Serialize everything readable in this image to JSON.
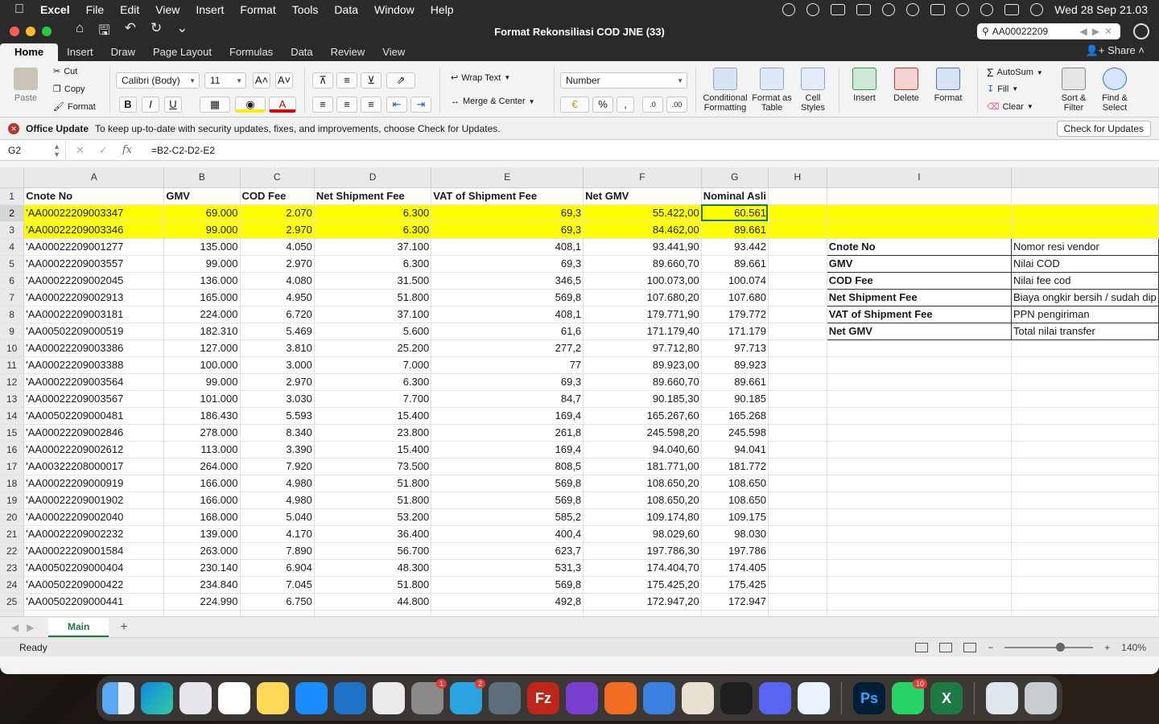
{
  "menubar": {
    "app": "Excel",
    "items": [
      "File",
      "Edit",
      "View",
      "Insert",
      "Format",
      "Tools",
      "Data",
      "Window",
      "Help"
    ],
    "clock": "Wed 28 Sep  21.03"
  },
  "window": {
    "title": "Format Rekonsiliasi COD JNE (33)",
    "search_value": "AA00022209",
    "tabs": [
      "Home",
      "Insert",
      "Draw",
      "Page Layout",
      "Formulas",
      "Data",
      "Review",
      "View"
    ],
    "share_label": "Share"
  },
  "ribbon": {
    "paste": "Paste",
    "cut": "Cut",
    "copy": "Copy",
    "format_painter": "Format",
    "font_name": "Calibri (Body)",
    "font_size": "11",
    "wrap_text": "Wrap Text",
    "merge_center": "Merge & Center",
    "number_format": "Number",
    "conditional_formatting": "Conditional Formatting",
    "format_as_table": "Format as Table",
    "cell_styles": "Cell Styles",
    "insert": "Insert",
    "delete": "Delete",
    "format": "Format",
    "autosum": "AutoSum",
    "fill": "Fill",
    "clear": "Clear",
    "sort_filter": "Sort & Filter",
    "find_select": "Find & Select"
  },
  "notice": {
    "title": "Office Update",
    "message": "To keep up-to-date with security updates, fixes, and improvements, choose Check for Updates.",
    "button": "Check for Updates"
  },
  "formula_bar": {
    "name_box": "G2",
    "formula": "=B2-C2-D2-E2"
  },
  "columns": [
    "A",
    "B",
    "C",
    "D",
    "E",
    "F",
    "G",
    "H",
    "I",
    ""
  ],
  "headers": [
    "Cnote No",
    "GMV",
    "COD Fee",
    "Net Shipment Fee",
    "VAT of Shipment Fee",
    "Net GMV",
    "Nominal Asli"
  ],
  "rows": [
    [
      "'AA00022209003347",
      "69.000",
      "2.070",
      "6.300",
      "69,3",
      "55.422,00",
      "60.561"
    ],
    [
      "'AA00022209003346",
      "99.000",
      "2.970",
      "6.300",
      "69,3",
      "84.462,00",
      "89.661"
    ],
    [
      "'AA00022209001277",
      "135.000",
      "4.050",
      "37.100",
      "408,1",
      "93.441,90",
      "93.442"
    ],
    [
      "'AA00022209003557",
      "99.000",
      "2.970",
      "6.300",
      "69,3",
      "89.660,70",
      "89.661"
    ],
    [
      "'AA00022209002045",
      "136.000",
      "4.080",
      "31.500",
      "346,5",
      "100.073,00",
      "100.074"
    ],
    [
      "'AA00022209002913",
      "165.000",
      "4.950",
      "51.800",
      "569,8",
      "107.680,20",
      "107.680"
    ],
    [
      "'AA00022209003181",
      "224.000",
      "6.720",
      "37.100",
      "408,1",
      "179.771,90",
      "179.772"
    ],
    [
      "'AA00502209000519",
      "182.310",
      "5.469",
      "5.600",
      "61,6",
      "171.179,40",
      "171.179"
    ],
    [
      "'AA00022209003386",
      "127.000",
      "3.810",
      "25.200",
      "277,2",
      "97.712,80",
      "97.713"
    ],
    [
      "'AA00022209003388",
      "100.000",
      "3.000",
      "7.000",
      "77",
      "89.923,00",
      "89.923"
    ],
    [
      "'AA00022209003564",
      "99.000",
      "2.970",
      "6.300",
      "69,3",
      "89.660,70",
      "89.661"
    ],
    [
      "'AA00022209003567",
      "101.000",
      "3.030",
      "7.700",
      "84,7",
      "90.185,30",
      "90.185"
    ],
    [
      "'AA00502209000481",
      "186.430",
      "5.593",
      "15.400",
      "169,4",
      "165.267,60",
      "165.268"
    ],
    [
      "'AA00022209002846",
      "278.000",
      "8.340",
      "23.800",
      "261,8",
      "245.598,20",
      "245.598"
    ],
    [
      "'AA00022209002612",
      "113.000",
      "3.390",
      "15.400",
      "169,4",
      "94.040,60",
      "94.041"
    ],
    [
      "'AA00322208000017",
      "264.000",
      "7.920",
      "73.500",
      "808,5",
      "181.771,00",
      "181.772"
    ],
    [
      "'AA00022209000919",
      "166.000",
      "4.980",
      "51.800",
      "569,8",
      "108.650,20",
      "108.650"
    ],
    [
      "'AA00022209001902",
      "166.000",
      "4.980",
      "51.800",
      "569,8",
      "108.650,20",
      "108.650"
    ],
    [
      "'AA00022209002040",
      "168.000",
      "5.040",
      "53.200",
      "585,2",
      "109.174,80",
      "109.175"
    ],
    [
      "'AA00022209002232",
      "139.000",
      "4.170",
      "36.400",
      "400,4",
      "98.029,60",
      "98.030"
    ],
    [
      "'AA00022209001584",
      "263.000",
      "7.890",
      "56.700",
      "623,7",
      "197.786,30",
      "197.786"
    ],
    [
      "'AA00502209000404",
      "230.140",
      "6.904",
      "48.300",
      "531,3",
      "174.404,70",
      "174.405"
    ],
    [
      "'AA00502209000422",
      "234.840",
      "7.045",
      "51.800",
      "569,8",
      "175.425,20",
      "175.425"
    ],
    [
      "'AA00502209000441",
      "224.990",
      "6.750",
      "44.800",
      "492,8",
      "172.947,20",
      "172.947"
    ]
  ],
  "legend": [
    [
      "Cnote No",
      "Nomor resi vendor"
    ],
    [
      "GMV",
      "Nilai COD"
    ],
    [
      "COD Fee",
      "Nilai fee cod"
    ],
    [
      "Net Shipment Fee",
      "Biaya ongkir bersih / sudah dip"
    ],
    [
      "VAT of Shipment Fee",
      "PPN pengiriman"
    ],
    [
      "Net GMV",
      "Total nilai transfer"
    ]
  ],
  "sheet_tab": "Main",
  "status": {
    "ready": "Ready",
    "zoom": "140%"
  },
  "dock": {
    "badges": {
      "settings": "1",
      "telegram": "2",
      "whatsapp": "10"
    },
    "labels": {
      "filezilla": "Fz",
      "photoshop": "Ps",
      "excel": "X"
    }
  }
}
